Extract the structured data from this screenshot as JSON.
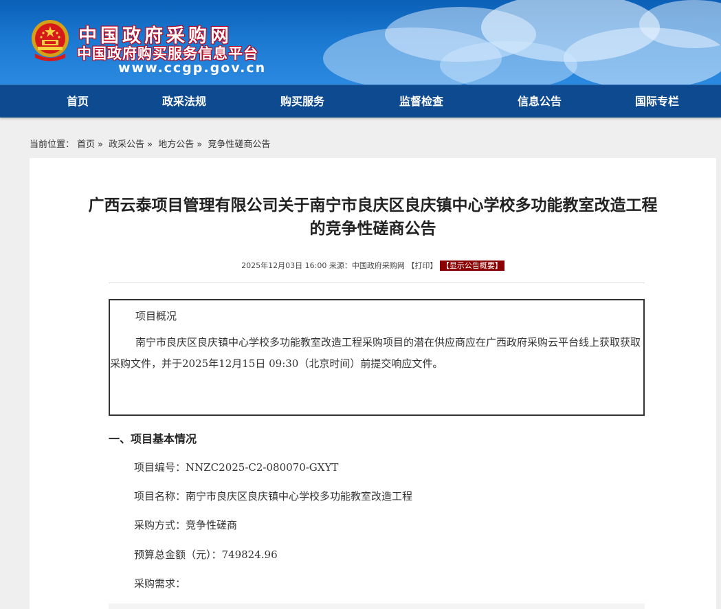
{
  "header": {
    "site_title": "中国政府采购网",
    "site_subtitle": "中国政府购买服务信息平台",
    "site_url": "www.ccgp.gov.cn",
    "emblem_icon": "national-emblem-icon",
    "colors": {
      "banner": "#1a78d0",
      "nav": "#0d4a8f",
      "title_outline": "#c2001a"
    }
  },
  "nav": {
    "items": [
      {
        "label": "首页"
      },
      {
        "label": "政采法规"
      },
      {
        "label": "购买服务"
      },
      {
        "label": "监督检查"
      },
      {
        "label": "信息公告"
      },
      {
        "label": "国际专栏"
      }
    ]
  },
  "breadcrumb": {
    "prefix": "当前位置：",
    "items": [
      "首页",
      "政采公告",
      "地方公告",
      "竞争性磋商公告"
    ],
    "separator": "»"
  },
  "article": {
    "title_line1": "广西云泰项目管理有限公司关于南宁市良庆区良庆镇中心学校多功能教室改造工程",
    "title_line2": "的竞争性磋商公告",
    "datetime": "2025年12月03日 16:00",
    "source_label": "来源：",
    "source": "中国政府采购网",
    "print_label": "【打印】",
    "show_summary_label": "【显示公告概要】",
    "summary": {
      "heading": "项目概况",
      "text": "南宁市良庆区良庆镇中心学校多功能教室改造工程采购项目的潜在供应商应在广西政府采购云平台线上获取获取采购文件，并于2025年12月15日 09:30（北京时间）前提交响应文件。"
    },
    "section1": {
      "heading": "一、项目基本情况",
      "project_no": "项目编号：NNZC2025-C2-080070-GXYT",
      "project_name": "项目名称：南宁市良庆区良庆镇中心学校多功能教室改造工程",
      "method": "采购方式：竞争性磋商",
      "budget": "预算总金额（元）：749824.96",
      "demand": "采购需求："
    }
  }
}
